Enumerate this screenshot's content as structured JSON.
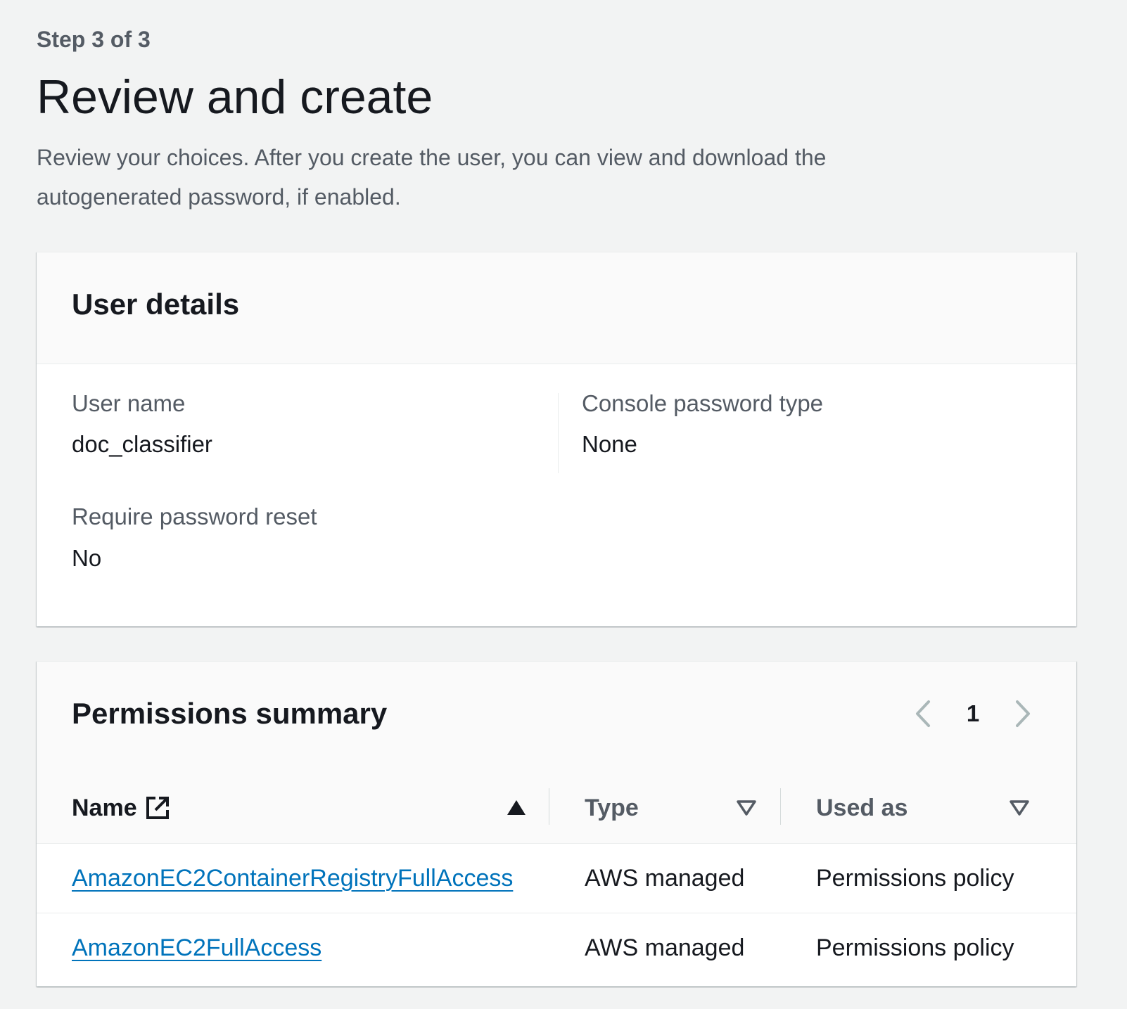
{
  "header": {
    "step": "Step 3 of 3",
    "title": "Review and create",
    "description": "Review your choices. After you create the user, you can view and download the autogenerated password, if enabled."
  },
  "user_details": {
    "title": "User details",
    "fields": [
      {
        "label": "User name",
        "value": "doc_classifier"
      },
      {
        "label": "Console password type",
        "value": "None"
      },
      {
        "label": "Require password reset",
        "value": "No"
      }
    ]
  },
  "permissions": {
    "title": "Permissions summary",
    "pagination": {
      "current_page": "1"
    },
    "columns": [
      {
        "label": "Name",
        "sort": "ascending",
        "icon": "external-link-icon"
      },
      {
        "label": "Type",
        "sort": "none"
      },
      {
        "label": "Used as",
        "sort": "none"
      }
    ],
    "rows": [
      {
        "name": "AmazonEC2ContainerRegistryFullAccess",
        "type": "AWS managed",
        "used_as": "Permissions policy"
      },
      {
        "name": "AmazonEC2FullAccess",
        "type": "AWS managed",
        "used_as": "Permissions policy"
      }
    ]
  },
  "colors": {
    "link": "#0073bb",
    "text": "#16191f",
    "muted": "#545b64",
    "background": "#f2f3f3"
  }
}
